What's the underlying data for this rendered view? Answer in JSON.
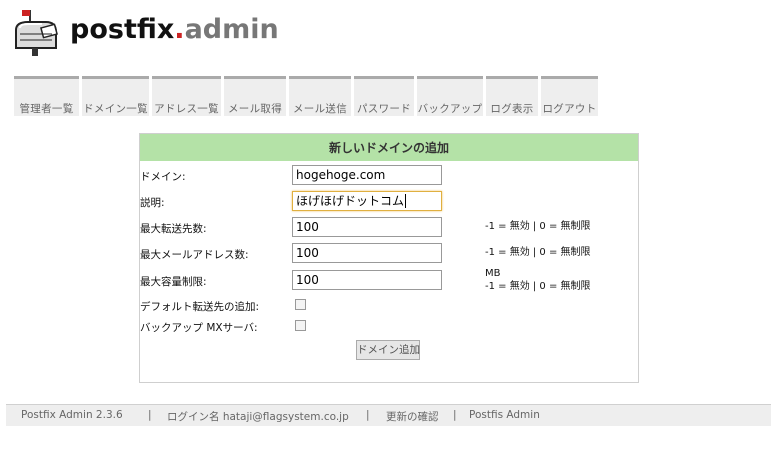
{
  "logo": {
    "part1": "postfix",
    "dot": ".",
    "part2": "admin"
  },
  "menu": [
    "管理者一覧",
    "ドメイン一覧",
    "アドレス一覧",
    "メール取得",
    "メール送信",
    "パスワード",
    "バックアップ",
    "ログ表示",
    "ログアウト"
  ],
  "form": {
    "title": "新しいドメインの追加",
    "domain_label": "ドメイン:",
    "domain_value": "hogehoge.com",
    "description_label": "説明:",
    "description_value": "ほげほげドットコム",
    "max_aliases_label": "最大転送先数:",
    "max_aliases_value": "100",
    "max_aliases_hint": "-1 = 無効 | 0 = 無制限",
    "max_mailboxes_label": "最大メールアドレス数:",
    "max_mailboxes_value": "100",
    "max_mailboxes_hint": "-1 = 無効 | 0 = 無制限",
    "max_quota_label": "最大容量制限:",
    "max_quota_value": "100",
    "max_quota_unit": "MB",
    "max_quota_hint": "-1 = 無効 | 0 = 無制限",
    "default_aliases_label": "デフォルト転送先の追加:",
    "default_aliases_checked": false,
    "backup_mx_label": "バックアップ MXサーバ:",
    "backup_mx_checked": false,
    "submit_label": "ドメイン追加"
  },
  "footer": {
    "version": "Postfix Admin 2.3.6",
    "login_label": "ログイン名 hataji@flagsystem.co.jp",
    "check_updates": "更新の確認",
    "home_link": "Postfis Admin",
    "separator": "|"
  },
  "colors": {
    "header_bg": "#b4e2a7",
    "menu_bg": "#eeeeee",
    "menu_top_border": "#aaaaaa",
    "logo_dot": "#cc2222"
  }
}
